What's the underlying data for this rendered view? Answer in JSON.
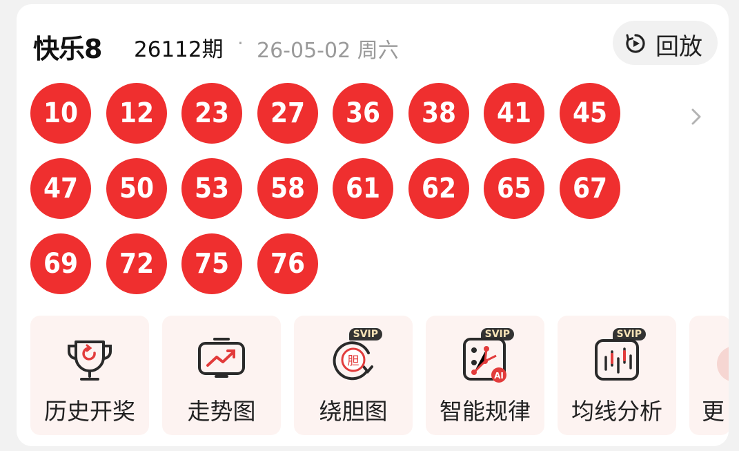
{
  "header": {
    "title": "快乐8",
    "issue": "26112期",
    "separator": "·",
    "date": "26-05-02 周六",
    "replay_label": "回放"
  },
  "balls": [
    "10",
    "12",
    "23",
    "27",
    "36",
    "38",
    "41",
    "45",
    "47",
    "50",
    "53",
    "58",
    "61",
    "62",
    "65",
    "67",
    "69",
    "72",
    "75",
    "76"
  ],
  "features": [
    {
      "label": "历史开奖",
      "icon": "trophy-icon",
      "svip": ""
    },
    {
      "label": "走势图",
      "icon": "trend-chart-icon",
      "svip": ""
    },
    {
      "label": "绕胆图",
      "icon": "cycle-dan-icon",
      "svip": "SVIP"
    },
    {
      "label": "智能规律",
      "icon": "ai-pattern-icon",
      "svip": "SVIP"
    },
    {
      "label": "均线分析",
      "icon": "moving-average-icon",
      "svip": "SVIP"
    },
    {
      "label": "更",
      "icon": "more-icon",
      "svip": ""
    }
  ],
  "colors": {
    "ball": "#ef2f2f",
    "accent": "#e23b3b",
    "feature_bg": "#fdf3f1",
    "svip_bg": "#333333",
    "svip_text": "#f5e2b6"
  }
}
